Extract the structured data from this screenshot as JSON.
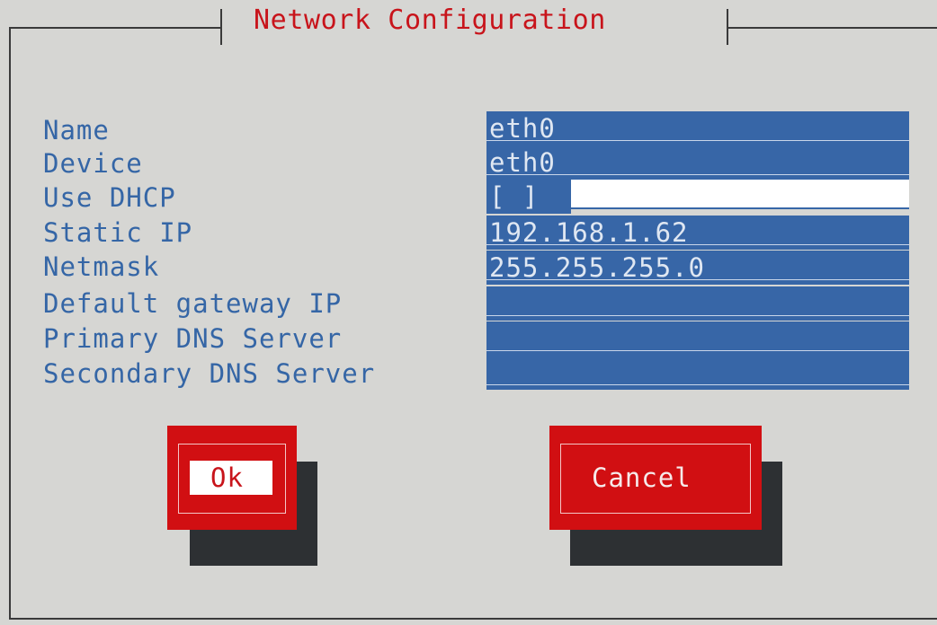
{
  "dialog": {
    "title": "Network Configuration"
  },
  "form": {
    "fields": [
      {
        "label": "Name",
        "value": "eth0",
        "type": "text"
      },
      {
        "label": "Device",
        "value": "eth0",
        "type": "text"
      },
      {
        "label": "Use DHCP",
        "value": "[ ]",
        "type": "checkbox",
        "checked": false
      },
      {
        "label": "Static IP",
        "value": "192.168.1.62",
        "type": "text"
      },
      {
        "label": "Netmask",
        "value": "255.255.255.0",
        "type": "text"
      },
      {
        "label": "Default gateway IP",
        "value": "",
        "type": "text"
      },
      {
        "label": "Primary DNS Server",
        "value": "",
        "type": "text"
      },
      {
        "label": "Secondary DNS Server",
        "value": "",
        "type": "text"
      }
    ]
  },
  "buttons": {
    "ok_label": "Ok",
    "cancel_label": "Cancel"
  },
  "colors": {
    "background": "#d6d6d3",
    "title": "#c8141b",
    "label": "#3566a6",
    "field": "#3766a7",
    "field_text": "#dfe7f2",
    "button": "#d10f12",
    "button_shadow": "#2d3033",
    "ok_focus": "#ffffff"
  }
}
